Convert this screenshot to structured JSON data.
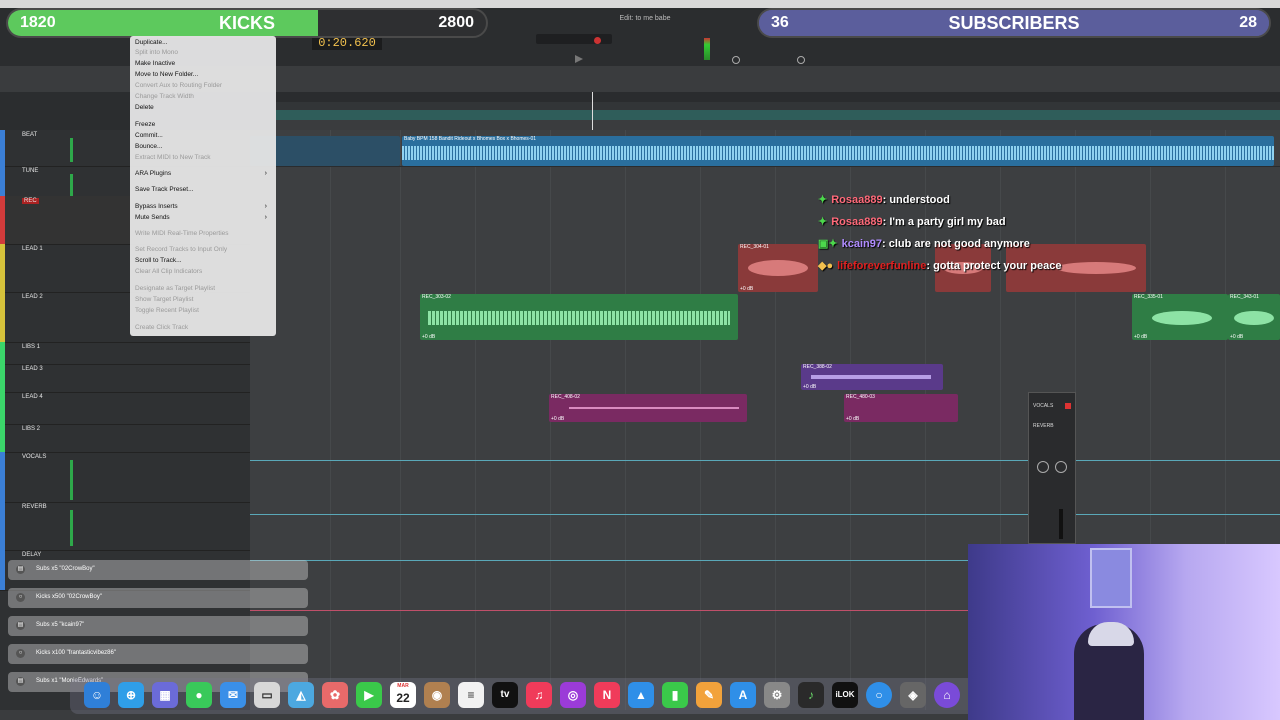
{
  "overlay": {
    "kicks": {
      "left": "1820",
      "label": "KICKS",
      "right": "2800"
    },
    "subs": {
      "left": "36",
      "label": "SUBSCRIBERS",
      "right": "28"
    }
  },
  "transport": {
    "counter": "0:20.620",
    "session_title": "Edit: to me babe"
  },
  "context_menu": {
    "items": [
      {
        "label": "Duplicate...",
        "enabled": true
      },
      {
        "label": "Split into Mono",
        "enabled": false
      },
      {
        "label": "Make Inactive",
        "enabled": true
      },
      {
        "label": "Move to New Folder...",
        "enabled": true
      },
      {
        "label": "Convert Aux to Routing Folder",
        "enabled": false
      },
      {
        "label": "Change Track Width",
        "enabled": false
      },
      {
        "label": "Delete",
        "enabled": true
      },
      {
        "label": "Freeze",
        "enabled": true
      },
      {
        "label": "Commit...",
        "enabled": true
      },
      {
        "label": "Bounce...",
        "enabled": true
      },
      {
        "label": "Extract MIDI to New Track",
        "enabled": false
      },
      {
        "label": "ARA Plugins",
        "enabled": true,
        "submenu": true
      },
      {
        "label": "Save Track Preset...",
        "enabled": true
      },
      {
        "label": "Bypass Inserts",
        "enabled": true,
        "submenu": true
      },
      {
        "label": "Mute Sends",
        "enabled": true,
        "submenu": true
      },
      {
        "label": "Write MIDI Real-Time Properties",
        "enabled": false
      },
      {
        "label": "Set Record Tracks to Input Only",
        "enabled": false
      },
      {
        "label": "Scroll to Track...",
        "enabled": true
      },
      {
        "label": "Clear All Clip Indicators",
        "enabled": false
      },
      {
        "label": "Designate as Target Playlist",
        "enabled": false
      },
      {
        "label": "Show Target Playlist",
        "enabled": false
      },
      {
        "label": "Toggle Recent Playlist",
        "enabled": false
      },
      {
        "label": "Create Click Track",
        "enabled": false
      }
    ]
  },
  "tracks": [
    {
      "name": "BEAT",
      "color": "#3b7fd6"
    },
    {
      "name": "TUNE",
      "color": "#3b7fd6"
    },
    {
      "name": "REC",
      "color": "#d23b3b"
    },
    {
      "name": "LEAD 1",
      "color": "#d6c23b"
    },
    {
      "name": "LEAD 2",
      "color": "#d6c23b"
    },
    {
      "name": "LIBS 1",
      "color": "#3bd66a"
    },
    {
      "name": "LEAD 3",
      "color": "#3bd66a"
    },
    {
      "name": "LEAD 4",
      "color": "#3bd66a"
    },
    {
      "name": "LIBS 2",
      "color": "#3bd66a"
    },
    {
      "name": "VOCALS",
      "color": "#3b7fd6"
    },
    {
      "name": "REVERB",
      "color": "#3b7fd6"
    },
    {
      "name": "DELAY",
      "color": "#3b7fd6"
    }
  ],
  "clips": {
    "beat": {
      "name": "Baby BPM 158 Bandit Rideout x Bhomes Box x Bhomes-01",
      "color": "#2a6f9e"
    },
    "rec1": {
      "name": "REC_304-01",
      "gain": "+0 dB",
      "color": "#8a3a3a"
    },
    "lead2a": {
      "name": "REC_303-02",
      "gain": "+0 dB",
      "color": "#2f7d45"
    },
    "lead2b": {
      "name": "REC_335-01",
      "gain": "+0 dB",
      "color": "#2f7d45"
    },
    "lead2c": {
      "name": "REC_343-01",
      "gain": "+0 dB",
      "color": "#2f7d45"
    },
    "lead3a": {
      "name": "REC_388-02",
      "gain": "+0 dB",
      "color": "#5a3a8a"
    },
    "lead4a": {
      "name": "REC_408-02",
      "gain": "+0 dB",
      "color": "#7a2a62"
    },
    "lead4b": {
      "name": "REC_480-03",
      "gain": "+0 dB",
      "color": "#7a2a62"
    }
  },
  "chat": [
    {
      "user": "Rosaa889",
      "message": ": understood"
    },
    {
      "user": "Rosaa889",
      "message": ": I'm a party girl my bad"
    },
    {
      "user": "kcain97",
      "message": ": club are not good anymore"
    },
    {
      "user": "lifeforeverfunline",
      "message": ": gotta protect your peace"
    }
  ],
  "notifications": [
    {
      "text": "Subs x5 \"02CrowBoy\""
    },
    {
      "text": "Kicks x500 \"02CrowBoy\""
    },
    {
      "text": "Subs x5 \"kcain97\""
    },
    {
      "text": "Kicks x100 \"frantasticvibez86\""
    },
    {
      "text": "Subs x1 \"MonieEdwards\""
    }
  ],
  "dock": {
    "calendar_month": "MAR",
    "calendar_day": "22",
    "apple_tv": "tv",
    "ilok": "iLOK"
  },
  "plugin": {
    "title": "VOCALS",
    "label": "REVERB"
  }
}
